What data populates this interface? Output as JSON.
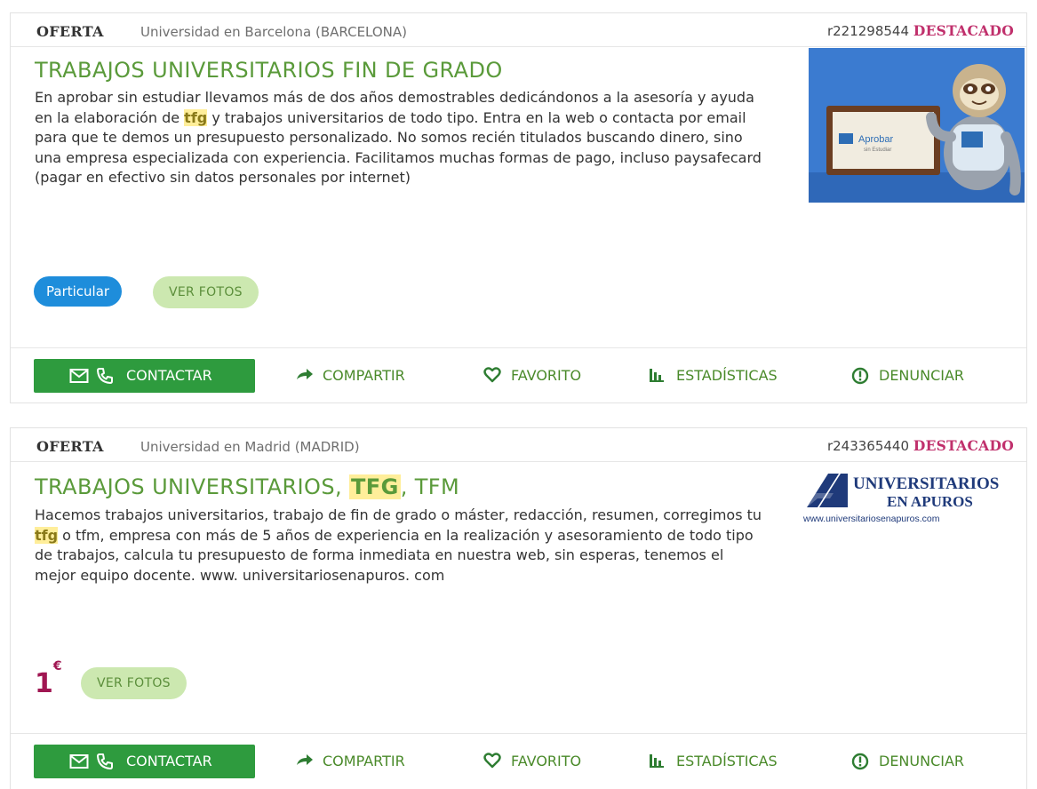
{
  "listings": [
    {
      "kind": "OFERTA",
      "location": "Universidad en Barcelona (BARCELONA)",
      "ref": "r221298544",
      "featured": "DESTACADO",
      "title": "TRABAJOS UNIVERSITARIOS FIN DE GRADO",
      "desc_before": "En aprobar sin estudiar llevamos más de dos años demostrables dedicándonos a la asesoría y ayuda en la elaboración de ",
      "desc_highlight": "tfg",
      "desc_after": " y trabajos universitarios de todo tipo. Entra en la web o contacta por email para que te demos un presupuesto personalizado. No somos recién titulados buscando dinero, sino una empresa especializada con experiencia. Facilitamos muchas formas de pago, incluso paysafecard (pagar en efectivo sin datos personales por internet)",
      "badge": "Particular",
      "photos_label": "VER FOTOS",
      "thumb_sign_text": "Aprobar",
      "thumb_sign_sub": "sin Estudiar",
      "actions": {
        "contact": "CONTACTAR",
        "share": "COMPARTIR",
        "favorite": "FAVORITO",
        "stats": "ESTADÍSTICAS",
        "report": "DENUNCIAR"
      }
    },
    {
      "kind": "OFERTA",
      "location": "Universidad en Madrid (MADRID)",
      "ref": "r243365440",
      "featured": "DESTACADO",
      "title_before": "TRABAJOS UNIVERSITARIOS, ",
      "title_highlight": "TFG",
      "title_after": ", TFM",
      "desc_before": "Hacemos trabajos universitarios, trabajo de fin de grado o máster, redacción, resumen, corregimos tu ",
      "desc_highlight": "tfg",
      "desc_after": " o tfm, empresa con más de 5 años de experiencia en la realización y asesoramiento de todo tipo de trabajos, calcula tu presupuesto de forma inmediata en nuestra web, sin esperas, tenemos el mejor equipo docente. www. universitariosenapuros. com",
      "price": "1",
      "currency": "€",
      "photos_label": "VER FOTOS",
      "logo_line1": "UNIVERSITARIOS",
      "logo_line2": "EN APUROS",
      "logo_url": "www.universitariosenapuros.com",
      "actions": {
        "contact": "CONTACTAR",
        "share": "COMPARTIR",
        "favorite": "FAVORITO",
        "stats": "ESTADÍSTICAS",
        "report": "DENUNCIAR"
      }
    }
  ],
  "colors": {
    "title_green": "#5a9a3a",
    "featured_pink": "#c0306c",
    "contact_green": "#2e9b3e",
    "badge_blue": "#1e8ddb",
    "photos_bg": "#cce8b0",
    "price_red": "#a01652",
    "highlight_yellow": "#ffee9a"
  }
}
